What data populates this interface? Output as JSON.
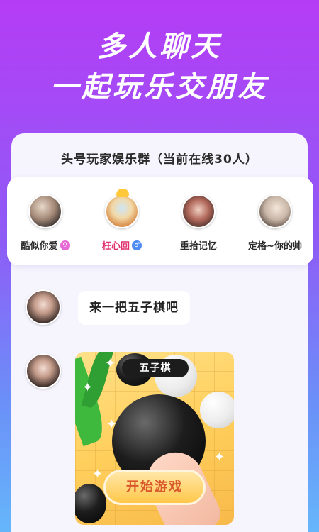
{
  "headline": {
    "line1": "多人聊天",
    "line2": "一起玩乐交朋友"
  },
  "group": {
    "title": "头号玩家娱乐群（当前在线30人）"
  },
  "members": [
    {
      "name": "酷似你爱",
      "badge": "♀",
      "badge_color": "#e56ad6",
      "vip": false
    },
    {
      "name": "枉心回",
      "badge": "♂",
      "badge_color": "#4d8cf5",
      "vip": true
    },
    {
      "name": "重拾记忆",
      "badge": "",
      "vip": false
    },
    {
      "name": "定格~你的帅",
      "badge": "",
      "vip": false
    }
  ],
  "chat": {
    "message1": "来一把五子棋吧",
    "game_card": {
      "game_name": "五子棋",
      "button_label": "开始游戏"
    }
  },
  "colors": {
    "background_top": "#b53cf5",
    "background_bottom": "#66b6fb",
    "vip_name": "#e0306e",
    "button_text": "#d8572b"
  }
}
